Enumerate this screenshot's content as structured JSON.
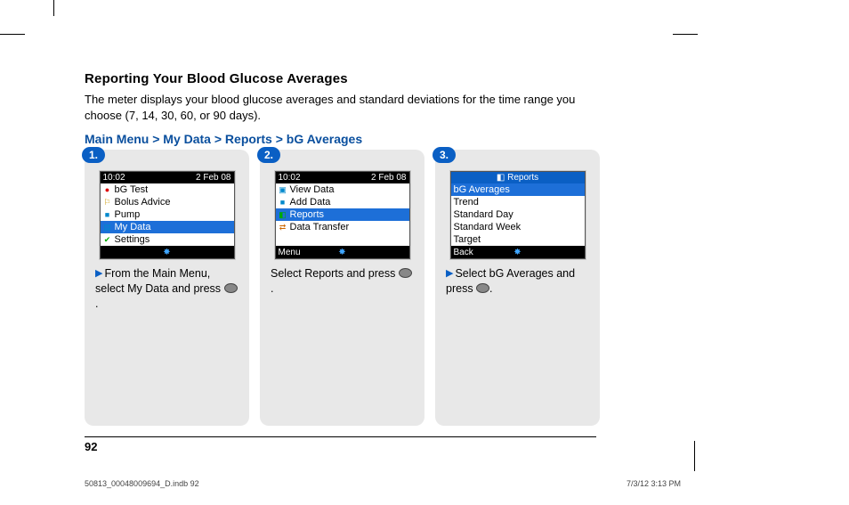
{
  "heading": "Reporting Your Blood Glucose Averages",
  "intro": "The meter displays your blood glucose averages and standard deviations for the time range you choose (7, 14, 30, 60, or 90 days).",
  "breadcrumb": "Main Menu > My Data > Reports > bG Averages",
  "page_number": "92",
  "footer_left": "50813_00048009694_D.indb   92",
  "footer_right": "7/3/12   3:13 PM",
  "steps": [
    {
      "num": "1.",
      "top_time": "10:02",
      "top_date": "2 Feb 08",
      "header": "",
      "items": [
        {
          "icon": "blood-drop-icon",
          "glyph": "●",
          "color": "#d00",
          "label": "bG Test",
          "selected": false
        },
        {
          "icon": "bolus-icon",
          "glyph": "⚐",
          "color": "#c90",
          "label": "Bolus Advice",
          "selected": false
        },
        {
          "icon": "pump-icon",
          "glyph": "■",
          "color": "#08c",
          "label": "Pump",
          "selected": false
        },
        {
          "icon": "folder-icon",
          "glyph": "▤",
          "color": "#08c",
          "label": "My Data",
          "selected": true
        },
        {
          "icon": "check-icon",
          "glyph": "✔",
          "color": "#0a0",
          "label": "Settings",
          "selected": false
        }
      ],
      "bottom_left": "",
      "bt_icon": "✸",
      "caption_lead_arrow": true,
      "caption": "From the Main Menu, select My Data and press ",
      "caption_suffix": "."
    },
    {
      "num": "2.",
      "top_time": "10:02",
      "top_date": "2 Feb 08",
      "header": "",
      "items": [
        {
          "icon": "view-icon",
          "glyph": "▣",
          "color": "#08c",
          "label": "View Data",
          "selected": false
        },
        {
          "icon": "add-icon",
          "glyph": "■",
          "color": "#08c",
          "label": "Add Data",
          "selected": false
        },
        {
          "icon": "chart-icon",
          "glyph": "◧",
          "color": "#0a0",
          "label": "Reports",
          "selected": true
        },
        {
          "icon": "transfer-icon",
          "glyph": "⇄",
          "color": "#c60",
          "label": "Data Transfer",
          "selected": false
        }
      ],
      "bottom_left": "Menu",
      "bt_icon": "✸",
      "caption_lead_arrow": false,
      "caption": "Select Reports and press ",
      "caption_suffix": "."
    },
    {
      "num": "3.",
      "top_time": "",
      "top_date": "",
      "header_icon": "◧",
      "header": "Reports",
      "items": [
        {
          "icon": "",
          "glyph": "",
          "color": "",
          "label": "bG Averages",
          "selected": true
        },
        {
          "icon": "",
          "glyph": "",
          "color": "",
          "label": "Trend",
          "selected": false
        },
        {
          "icon": "",
          "glyph": "",
          "color": "",
          "label": "Standard Day",
          "selected": false
        },
        {
          "icon": "",
          "glyph": "",
          "color": "",
          "label": "Standard Week",
          "selected": false
        },
        {
          "icon": "",
          "glyph": "",
          "color": "",
          "label": "Target",
          "selected": false
        }
      ],
      "bottom_left": "Back",
      "bt_icon": "✸",
      "caption_lead_arrow": true,
      "caption": "Select bG Averages and press ",
      "caption_suffix": "."
    }
  ]
}
